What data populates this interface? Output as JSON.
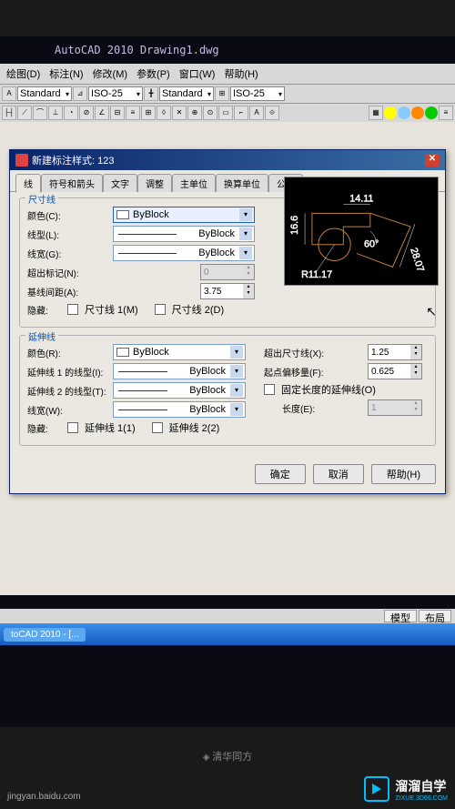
{
  "app": {
    "title": "AutoCAD 2010  Drawing1.dwg"
  },
  "menubar": [
    "绘图(D)",
    "标注(N)",
    "修改(M)",
    "参数(P)",
    "窗口(W)",
    "帮助(H)"
  ],
  "toolbar": {
    "combo1": "Standard",
    "combo2": "ISO-25",
    "combo3": "Standard",
    "combo4": "ISO-25"
  },
  "dialog": {
    "title": "新建标注样式: 123",
    "tabs": [
      "线",
      "符号和箭头",
      "文字",
      "调整",
      "主单位",
      "换算单位",
      "公差"
    ],
    "active_tab": "线",
    "dimline": {
      "group": "尺寸线",
      "color_label": "颜色(C):",
      "color_value": "ByBlock",
      "linetype_label": "线型(L):",
      "linetype_value": "ByBlock",
      "lineweight_label": "线宽(G):",
      "lineweight_value": "ByBlock",
      "beyond_label": "超出标记(N):",
      "beyond_value": "0",
      "baseline_label": "基线间距(A):",
      "baseline_value": "3.75",
      "hide_label": "隐藏:",
      "hide1": "尺寸线 1(M)",
      "hide2": "尺寸线 2(D)"
    },
    "extline": {
      "group": "延伸线",
      "color_label": "颜色(R):",
      "color_value": "ByBlock",
      "lt1_label": "延伸线 1 的线型(I):",
      "lt1_value": "ByBlock",
      "lt2_label": "延伸线 2 的线型(T):",
      "lt2_value": "ByBlock",
      "lw_label": "线宽(W):",
      "lw_value": "ByBlock",
      "hide_label": "隐藏:",
      "hide1": "延伸线 1(1)",
      "hide2": "延伸线 2(2)",
      "beyond_label": "超出尺寸线(X):",
      "beyond_value": "1.25",
      "offset_label": "起点偏移量(F):",
      "offset_value": "0.625",
      "fixed_label": "固定长度的延伸线(O)",
      "length_label": "长度(E):",
      "length_value": "1"
    },
    "preview": {
      "dim1": "14.11",
      "dim2": "16.6",
      "dim3": "28.07",
      "dim4": "R11.17",
      "dim5": "60°"
    },
    "buttons": {
      "ok": "确定",
      "cancel": "取消",
      "help": "帮助(H)"
    }
  },
  "statusbar": {
    "tab1": "模型",
    "tab2": "布局"
  },
  "taskbar": {
    "item": "toCAD 2010 - [..."
  },
  "monitor": "清华同方",
  "watermark": {
    "brand": "溜溜自学",
    "sub": "ZIXUE.3D66.COM",
    "bl": "jingyan.baidu.com"
  }
}
